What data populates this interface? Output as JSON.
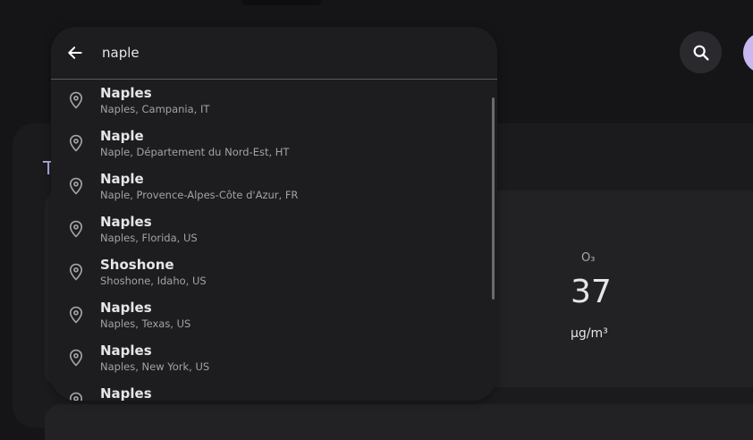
{
  "search": {
    "query": "naple"
  },
  "background": {
    "title_peek": "T",
    "metric_label": "O₃",
    "metric_value": "37",
    "metric_unit": "µg/m³"
  },
  "results": [
    {
      "title": "Naples",
      "subtitle": "Naples, Campania, IT"
    },
    {
      "title": "Naple",
      "subtitle": "Naple, Département du Nord-Est, HT"
    },
    {
      "title": "Naple",
      "subtitle": "Naple, Provence-Alpes-Côte d'Azur, FR"
    },
    {
      "title": "Naples",
      "subtitle": "Naples, Florida, US"
    },
    {
      "title": "Shoshone",
      "subtitle": "Shoshone, Idaho, US"
    },
    {
      "title": "Naples",
      "subtitle": "Naples, Texas, US"
    },
    {
      "title": "Naples",
      "subtitle": "Naples, New York, US"
    },
    {
      "title": "Naples",
      "subtitle": ""
    }
  ],
  "icons": {
    "back": "arrow-back-icon",
    "pin": "location-pin-icon",
    "search": "search-icon"
  },
  "colors": {
    "avatar": "#c9b8f0",
    "accent_text": "#b4b8e8"
  }
}
